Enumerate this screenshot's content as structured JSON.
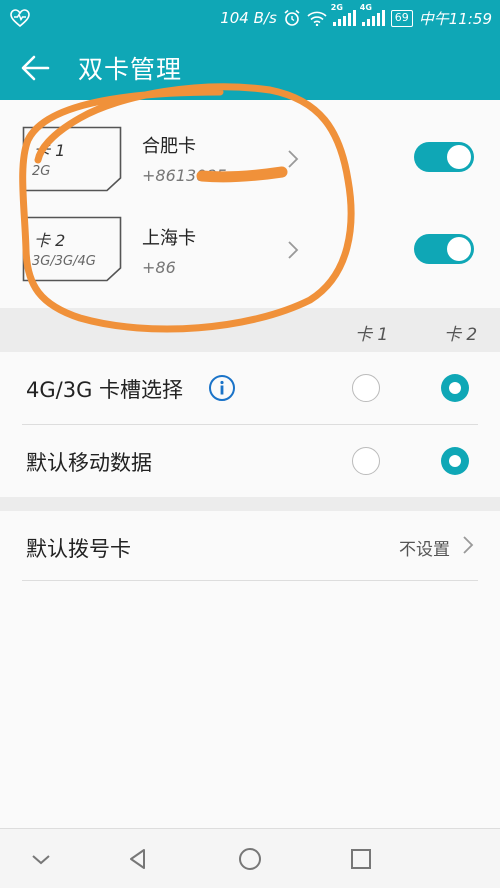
{
  "status_bar": {
    "speed": "104 B/s",
    "net1": "2G",
    "net2": "4G",
    "battery": "69",
    "time": "中午11:59"
  },
  "app_bar": {
    "back_icon": "arrow-left-icon",
    "title": "双卡管理"
  },
  "sims": [
    {
      "card_label": "卡 1",
      "bands": "2G",
      "name": "合肥卡",
      "number": "+8613085"
    },
    {
      "card_label": "卡 2",
      "bands": "3G/3G/4G",
      "name": "上海卡",
      "number": "+86"
    }
  ],
  "columns": {
    "card1": "卡 1",
    "card2": "卡 2"
  },
  "options": {
    "slot_select": {
      "label": "4G/3G 卡槽选择",
      "selected": "card2"
    },
    "default_data": {
      "label": "默认移动数据",
      "selected": "card2"
    }
  },
  "default_dial": {
    "label": "默认拨号卡",
    "value": "不设置"
  },
  "colors": {
    "accent": "#0fa7b6",
    "annotation": "#f0913a"
  }
}
